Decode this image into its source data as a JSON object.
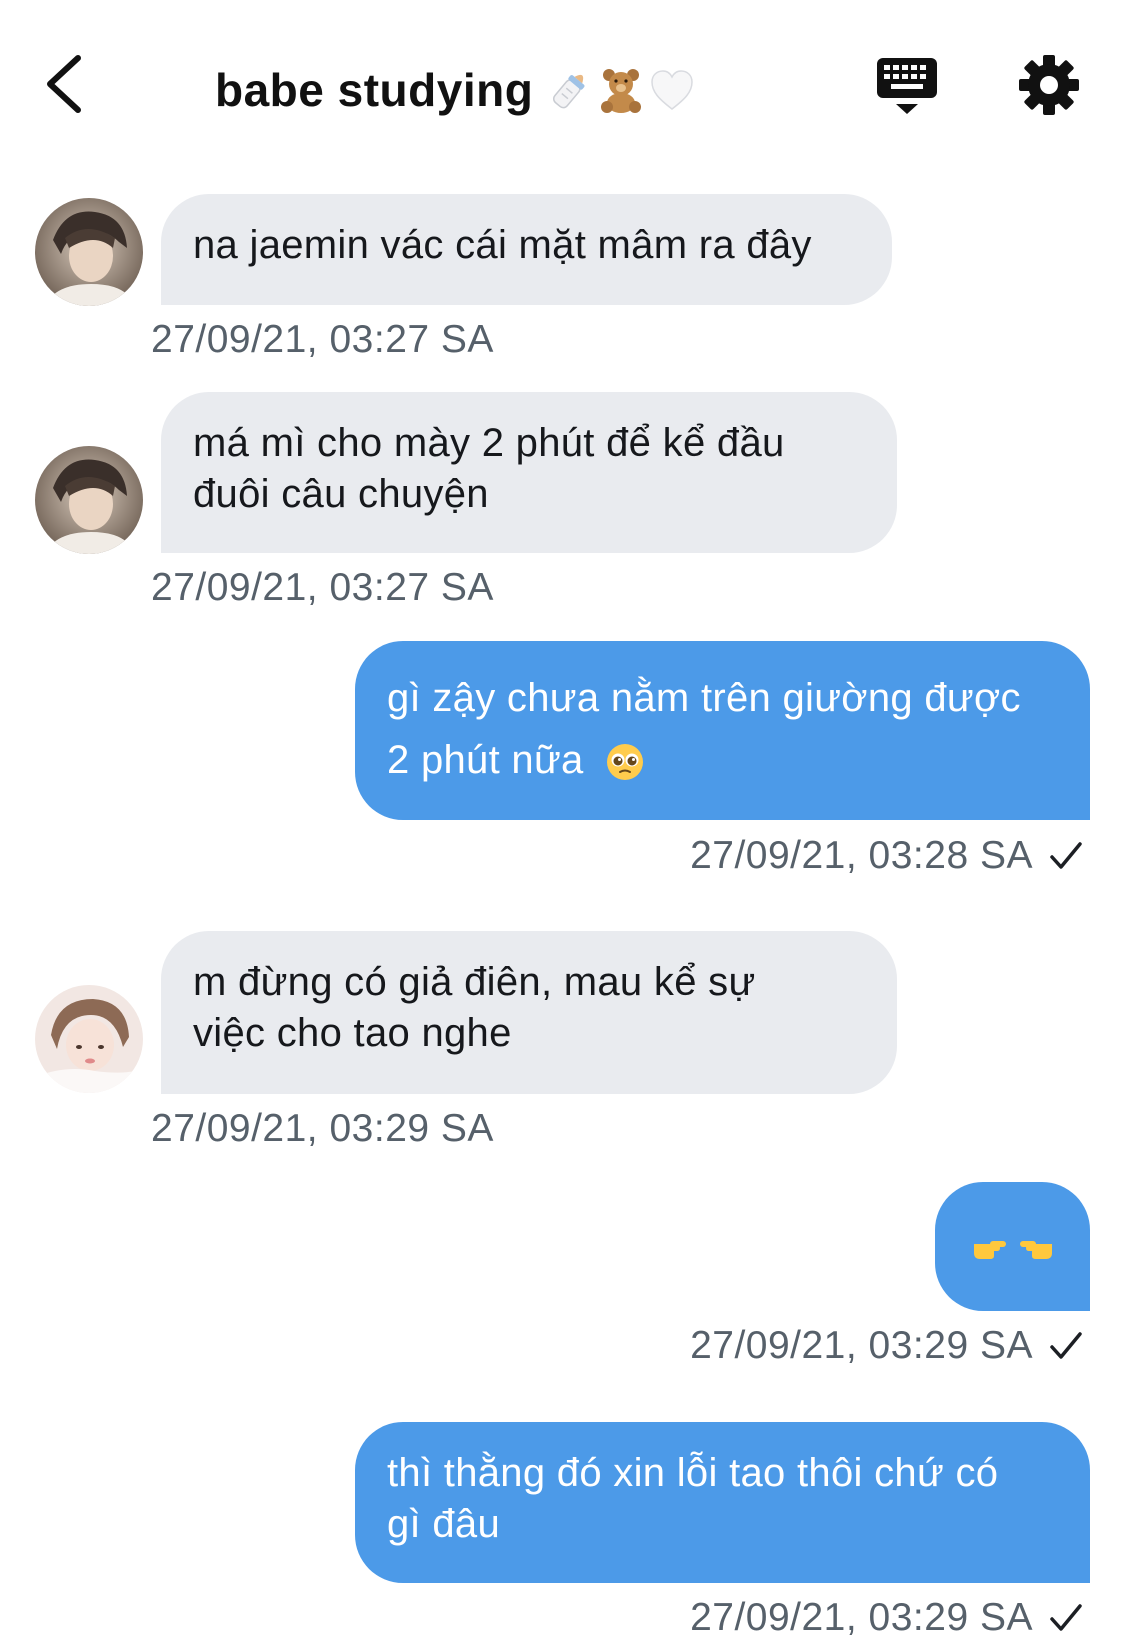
{
  "header": {
    "title": "babe studying",
    "title_emoji_icons": [
      "baby-bottle-icon",
      "teddy-bear-icon",
      "white-heart-icon"
    ],
    "back_icon": "chevron-left-icon",
    "keyboard_icon": "keyboard-hide-icon",
    "settings_icon": "gear-icon"
  },
  "colors": {
    "incoming_bubble": "#e9ebef",
    "outgoing_bubble": "#4c9ae8",
    "timestamp": "#56606a"
  },
  "messages": [
    {
      "direction": "in",
      "text": "na jaemin vác cái mặt mâm ra đây",
      "time": "27/09/21, 03:27 SA"
    },
    {
      "direction": "in",
      "lines": [
        "má mì cho mày 2 phút để kể đầu",
        "đuôi câu chuyện"
      ],
      "time": "27/09/21, 03:27 SA"
    },
    {
      "direction": "out",
      "lines": [
        "gì zậy chưa nằm trên giường được",
        "2 phút nữa"
      ],
      "emoji_icon": "pleading-face-icon",
      "time": "27/09/21, 03:28 SA",
      "status_icon": "check-icon"
    },
    {
      "direction": "in",
      "lines": [
        "m đừng có giả điên, mau kể sự",
        "việc cho tao nghe"
      ],
      "time": "27/09/21, 03:29 SA"
    },
    {
      "direction": "out",
      "emoji_icon": "pointing-fingers-icon",
      "time": "27/09/21, 03:29 SA",
      "status_icon": "check-icon"
    },
    {
      "direction": "out",
      "lines": [
        "thì thằng đó xin lỗi tao thôi chứ có",
        "gì đâu"
      ],
      "time": "27/09/21, 03:29 SA",
      "status_icon": "check-icon"
    }
  ]
}
